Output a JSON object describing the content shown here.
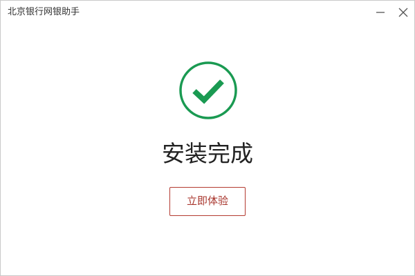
{
  "window": {
    "title": "北京银行网银助手"
  },
  "icons": {
    "minimize": "minimize-icon",
    "close": "close-icon",
    "status": "check-circle-icon"
  },
  "main": {
    "status_title": "安装完成",
    "action_label": "立即体验"
  },
  "colors": {
    "success": "#1a9a52",
    "accent": "#a8352c"
  }
}
